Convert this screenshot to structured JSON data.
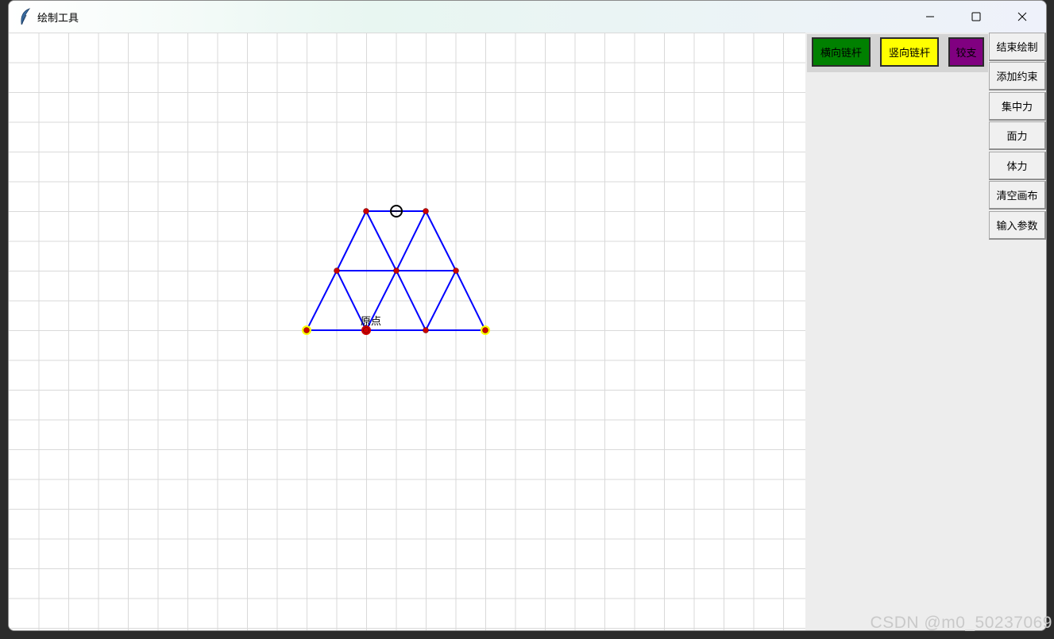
{
  "window": {
    "title": "绘制工具",
    "controls": [
      "minimize-icon",
      "maximize-icon",
      "close-icon"
    ]
  },
  "toolbar": {
    "buttons": [
      {
        "label": "横向链杆",
        "color": "#008000"
      },
      {
        "label": "竖向链杆",
        "color": "#ffff00"
      },
      {
        "label": "铰支",
        "color": "#800080"
      }
    ]
  },
  "sidebar": {
    "buttons": [
      {
        "label": "结束绘制"
      },
      {
        "label": "添加约束"
      },
      {
        "label": "集中力"
      },
      {
        "label": "面力"
      },
      {
        "label": "体力"
      },
      {
        "label": "清空画布"
      },
      {
        "label": "输入参数"
      }
    ]
  },
  "canvas": {
    "origin_label": "原点",
    "colors": {
      "grid": "#d9d9d9",
      "member": "#0000ff",
      "node": "#cc0000",
      "support": "#ffff00"
    }
  },
  "watermark": "CSDN @m0_50237069"
}
